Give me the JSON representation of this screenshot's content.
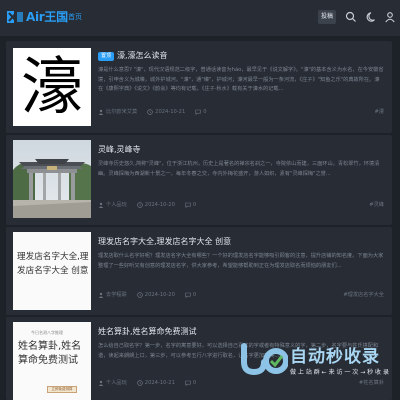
{
  "header": {
    "logo_text": "Air王国",
    "nav_home": "首页",
    "contribute": "投稿",
    "icons": [
      "search-icon",
      "moon-icon",
      "user-icon"
    ]
  },
  "colors": {
    "accent": "#2a9df4",
    "background": "#1d2229",
    "card": "#272c35",
    "muted_text": "#7d8590"
  },
  "posts": [
    {
      "badge": "置顶",
      "title": "濠,濠怎么读音",
      "image_text": "濠",
      "excerpt": "濠是什么意思? \"濠\"，现代汉语规范二级字，普通话读音为háo，最早见于《说文解字》。\"濠\"的基本含义为水名，在今安徽省境，引申含义为城壕，城外护城河。\"濠\"，通\"壕\"，护城河；濠河最早一般为一条河流，《庄子》\"知鱼之乐\"的典故所在。濠在《康熙字典》《说文》《韵会》等均有记载，《庄子·秋水》载有关于濠水的记载...",
      "author": "比尔欧米艾莫",
      "date": "2024-10-21",
      "comments": "0",
      "tag": "#漫"
    },
    {
      "badge": "",
      "title": "灵峰,灵峰寺",
      "image_text": "",
      "excerpt": "灵峰寺历史悠久,简称\"灵峰\"，位于浙江杭州，历史上是著名的禅宗名刹之一，寺院依山而建，三面环山，青松翠竹，环境清幽。灵峰探梅为西湖新十景之一，每年冬春之交，寺内外梅花盛开，游人如织，素有\"灵峰探梅\"之誉...",
      "author": "个人品玩",
      "date": "2024-10-20",
      "comments": "0",
      "tag": "#灵峰"
    },
    {
      "badge": "",
      "title": "理发店名字大全,理发店名字大全 创意",
      "image_text": "理发店名字大全,理发店名字大全 创意",
      "excerpt": "理发店取什么名字好呢？理发店名字大全有哪些？一个好的理发店名字能够吸引顾客的注意，提升店铺的知名度。下面为大家整理了一些好听又有创意的理发店名字，供大家参考，希望能够帮助到正在为理发店取名而烦恼的朋友们...",
      "author": "去学程联",
      "date": "2024-10-20",
      "comments": "0",
      "tag": "#理发店名字大全"
    },
    {
      "badge": "",
      "title": "姓名算卦,姓名算命免费测试",
      "image_text": "姓名算卦,姓名算命免费测试",
      "image_small": "今日名测八字推理",
      "image_button": "立即免费测算",
      "excerpt": "怎么给自己取名字？第一步，名字的寓意要好，可以选择自己喜欢的字或者有特殊意义的字，第二步，名字要与姓氏搭配和谐，读起来朗朗上口，第三步，可以参考五行八字进行取名，让名字更加完美...",
      "author": "个人品玩",
      "date": "2024-10-21",
      "comments": "0",
      "tag": "#姓名算卦"
    }
  ],
  "watermark": {
    "title": "自动秒收录",
    "subtitle": "做 上 站 群 ← 来 访 一 次 → 秒 收 录"
  }
}
